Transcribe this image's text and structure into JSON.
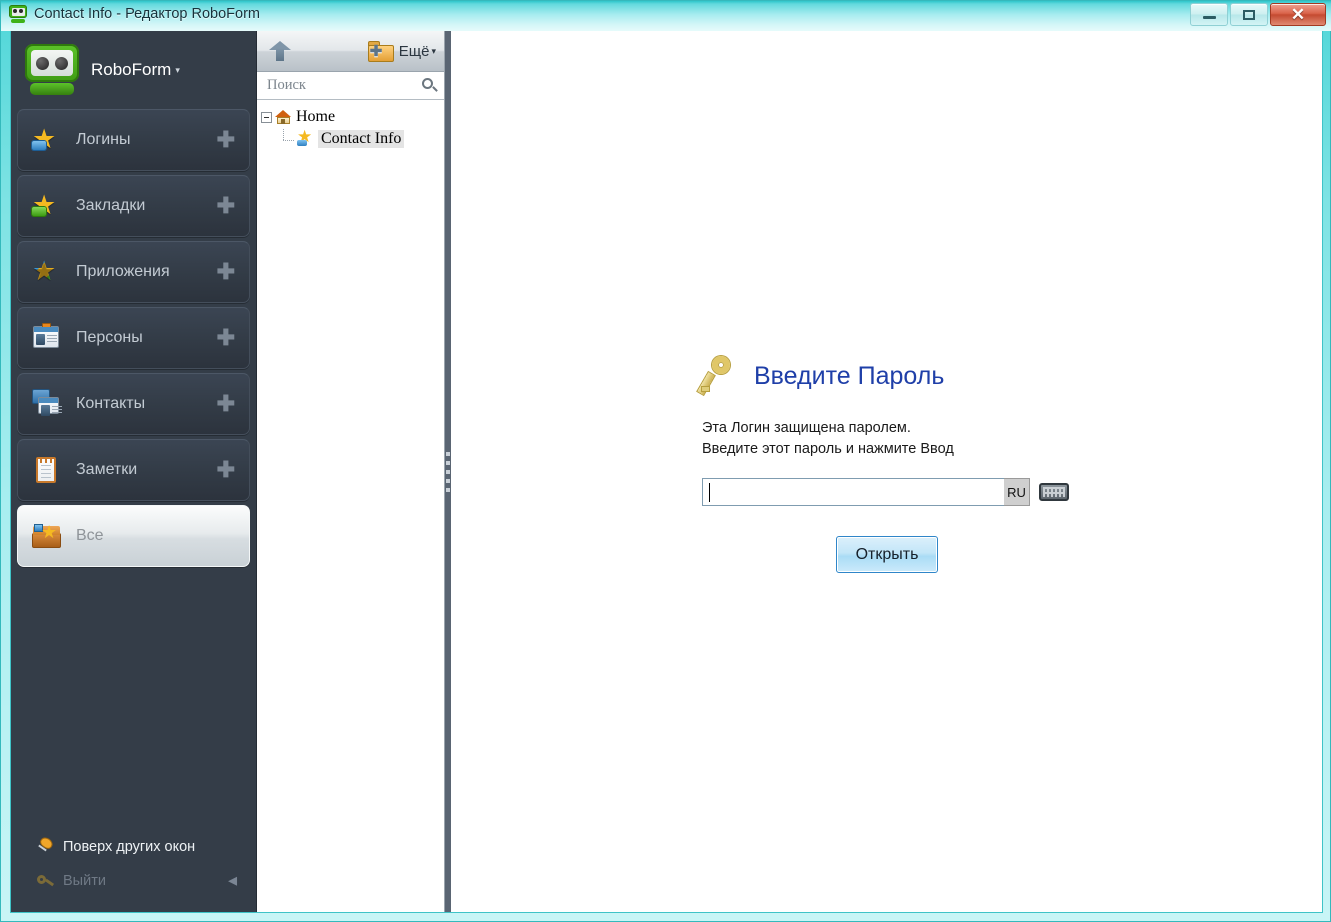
{
  "window": {
    "title": "Contact Info - Редактор RoboForm",
    "app_icon": "roboform-robot-icon",
    "minimize_label": "",
    "maximize_label": "",
    "close_label": "✕",
    "frame_color": "#4fd6d8"
  },
  "sidebar": {
    "brand": {
      "name": "RoboForm",
      "caret": "▾",
      "icon": "roboform-robot-icon"
    },
    "items": [
      {
        "label": "Логины",
        "icon": "star-logins-icon",
        "add": "✚",
        "selected": false
      },
      {
        "label": "Закладки",
        "icon": "star-bookmarks-icon",
        "add": "✚",
        "selected": false
      },
      {
        "label": "Приложения",
        "icon": "star-apps-icon",
        "add": "✚",
        "selected": false
      },
      {
        "label": "Персоны",
        "icon": "id-card-icon",
        "add": "✚",
        "selected": false
      },
      {
        "label": "Контакты",
        "icon": "contacts-cards-icon",
        "add": "✚",
        "selected": false
      },
      {
        "label": "Заметки",
        "icon": "notepad-icon",
        "add": "✚",
        "selected": false
      },
      {
        "label": "Все",
        "icon": "all-items-case-icon",
        "add": "",
        "selected": true
      }
    ],
    "bottom": [
      {
        "label": "Поверх других окон",
        "icon": "pin-icon",
        "dim": false,
        "arrow": ""
      },
      {
        "label": "Выйти",
        "icon": "key-icon",
        "dim": true,
        "arrow": "◄"
      }
    ]
  },
  "tree_panel": {
    "toolbar": {
      "up_icon": "up-arrow-icon",
      "new_folder_icon": "new-folder-icon",
      "more_label": "Ещё",
      "more_caret": "▾"
    },
    "search": {
      "placeholder": "Поиск",
      "value": "",
      "icon": "search-icon"
    },
    "nodes": [
      {
        "label": "Home",
        "icon": "home-house-icon",
        "expander": "−",
        "level": 0,
        "selected": false
      },
      {
        "label": "Contact Info",
        "icon": "star-login-icon",
        "expander": "",
        "level": 1,
        "selected": true
      }
    ]
  },
  "splitter": {
    "grip": "splitter-grip"
  },
  "main": {
    "icon": "key-icon",
    "title": "Введите Пароль",
    "desc_line1": "Эта Логин защищена паролем.",
    "desc_line2": "Введите этот пароль и нажмите Ввод",
    "password": {
      "value": "",
      "placeholder": ""
    },
    "lang_badge": "RU",
    "keyboard_icon": "virtual-keyboard-icon",
    "open_button": "Открыть",
    "title_color": "#1f3fa8"
  }
}
